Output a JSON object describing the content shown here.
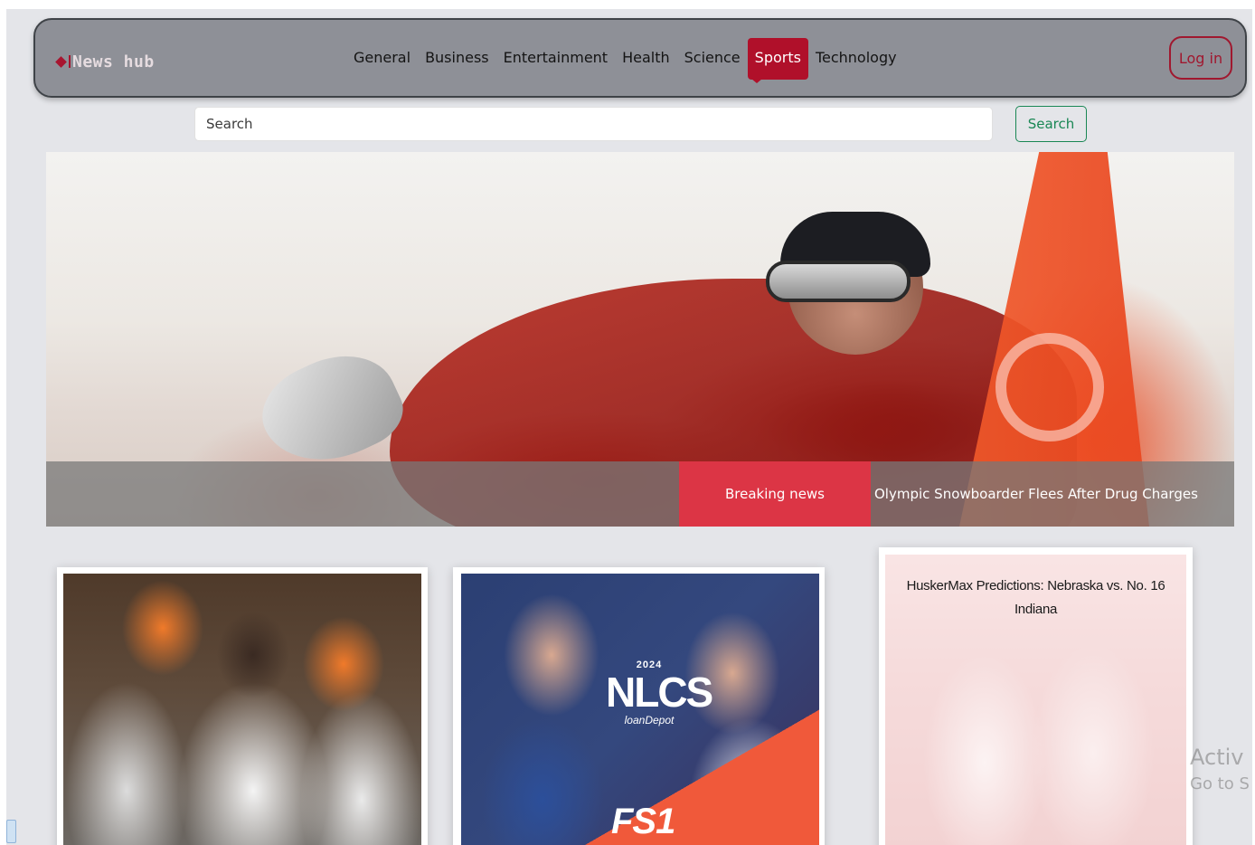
{
  "navbar": {
    "brand": "News hub",
    "items": [
      {
        "label": "General",
        "active": false
      },
      {
        "label": "Business",
        "active": false
      },
      {
        "label": "Entertainment",
        "active": false
      },
      {
        "label": "Health",
        "active": false
      },
      {
        "label": "Science",
        "active": false
      },
      {
        "label": "Sports",
        "active": true
      },
      {
        "label": "Technology",
        "active": false
      }
    ],
    "login_label": "Log in"
  },
  "search": {
    "placeholder": "Search",
    "button_label": "Search"
  },
  "hero": {
    "breaking_label": "Breaking news",
    "headline": "Olympic Snowboarder Flees After Drug Charges"
  },
  "cards": [
    {
      "title": ""
    },
    {
      "title": "",
      "logo_year": "2024",
      "logo_text": "NLCS",
      "logo_sponsor": "loanDepot",
      "network": "FS1"
    },
    {
      "title": "HuskerMax Predictions: Nebraska vs. No. 16 Indiana"
    }
  ],
  "watermark": {
    "line1": "Activ",
    "line2": "Go to S"
  },
  "colors": {
    "accent": "#b0102a",
    "navbar_bg": "#8e9097",
    "search_button": "#198754",
    "breaking": "#dc3545"
  }
}
